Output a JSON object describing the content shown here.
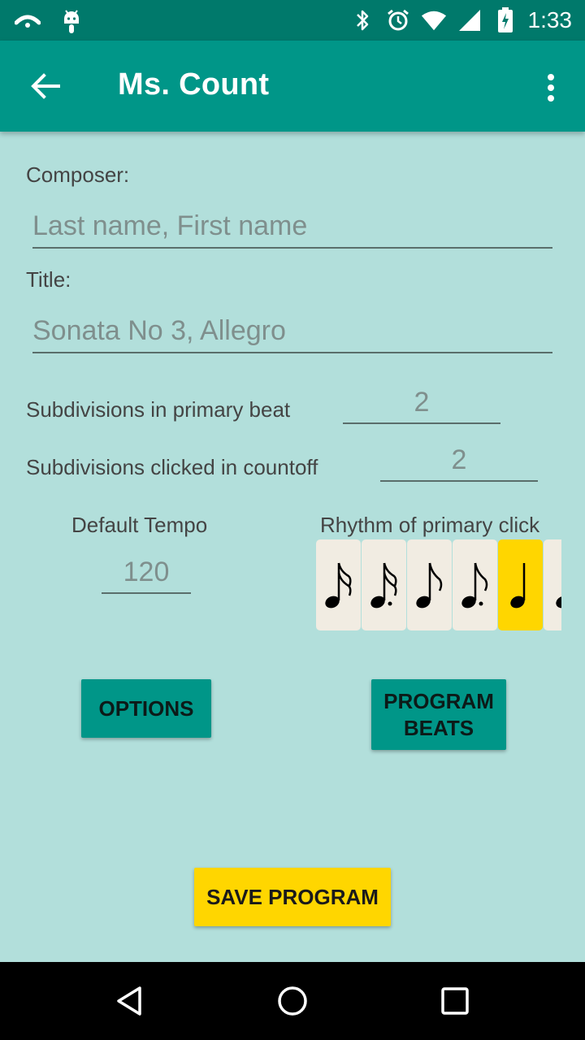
{
  "status_bar": {
    "time": "1:33",
    "left_icons": [
      "cast-icon",
      "android-icon"
    ],
    "right_icons": [
      "bluetooth-icon",
      "alarm-icon",
      "wifi-icon",
      "signal-icon",
      "battery-icon"
    ]
  },
  "app_bar": {
    "title": "Ms. Count"
  },
  "form": {
    "composer_label": "Composer:",
    "composer_placeholder": "Last name, First name",
    "title_label": "Title:",
    "title_placeholder": "Sonata No 3, Allegro",
    "subdiv_primary_label": "Subdivisions in primary beat",
    "subdiv_primary_value": "2",
    "subdiv_countoff_label": "Subdivisions clicked in countoff",
    "subdiv_countoff_value": "2",
    "tempo_label": "Default Tempo",
    "tempo_value": "120",
    "rhythm_label": "Rhythm of primary click"
  },
  "rhythm_options": [
    {
      "note": "sixteenth-note-icon",
      "selected": false
    },
    {
      "note": "dotted-sixteenth-note-icon",
      "selected": false
    },
    {
      "note": "eighth-note-icon",
      "selected": false
    },
    {
      "note": "dotted-eighth-note-icon",
      "selected": false
    },
    {
      "note": "quarter-note-icon",
      "selected": true
    },
    {
      "note": "dotted-quarter-note-icon",
      "selected": false
    }
  ],
  "buttons": {
    "options": "OPTIONS",
    "program_beats_line1": "PROGRAM",
    "program_beats_line2": "BEATS",
    "save_program": "SAVE PROGRAM"
  },
  "colors": {
    "status_bar": "#00796b",
    "app_bar": "#009688",
    "background": "#b2dfdb",
    "accent_yellow": "#ffd600",
    "tile": "#f1ece2"
  }
}
